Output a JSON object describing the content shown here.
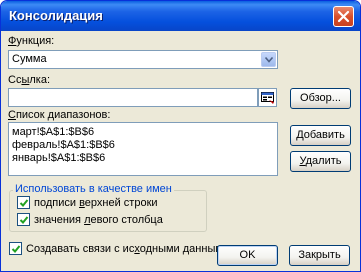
{
  "window": {
    "title": "Консолидация"
  },
  "function": {
    "label_prefix": "",
    "label_hotkey": "Ф",
    "label_rest": "ункция:",
    "value": "Сумма"
  },
  "reference": {
    "label_prefix": "Сс",
    "label_hotkey": "ы",
    "label_rest": "лка:",
    "value": ""
  },
  "ranges": {
    "label_prefix": "",
    "label_hotkey": "С",
    "label_rest": "писок диапазонов:",
    "items": [
      "март!$A$1:$B$6",
      "февраль!$A$1:$B$6",
      "январь!$A$1:$B$6"
    ]
  },
  "buttons": {
    "browse": {
      "prefix": "Обзор",
      "hotkey": "",
      "rest": "..."
    },
    "add": {
      "prefix": "",
      "hotkey": "Д",
      "rest": "обавить"
    },
    "delete": {
      "prefix": "",
      "hotkey": "У",
      "rest": "далить"
    },
    "ok": "OK",
    "close": "Закрыть"
  },
  "names_group": {
    "title": "Использовать в качестве имен",
    "top_row": {
      "prefix": "подписи ",
      "hotkey": "в",
      "rest": "ерхней строки",
      "checked": true
    },
    "left_column": {
      "prefix": "значения ",
      "hotkey": "л",
      "rest": "евого столбца",
      "checked": true
    }
  },
  "links": {
    "prefix": "Создавать связи с ис",
    "hotkey": "х",
    "rest": "одными данными",
    "checked": true
  },
  "icons": [
    "close-icon",
    "chevron-down-icon",
    "range-select-icon",
    "checkmark-icon"
  ],
  "colors": {
    "titlebar": "#0550dd",
    "dialog_bg": "#ece9d8",
    "group_title": "#0046d5",
    "checkmark": "#21a121"
  }
}
